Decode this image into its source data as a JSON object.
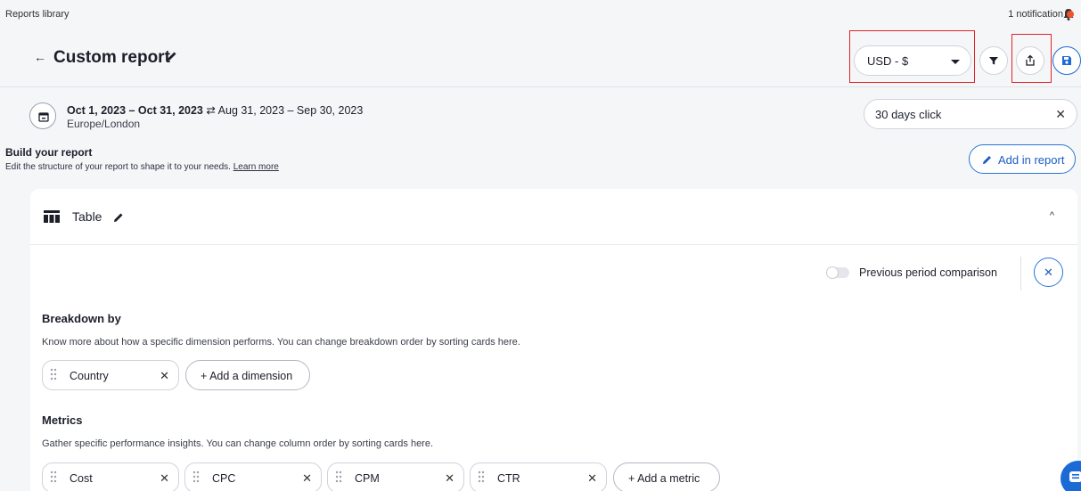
{
  "topbar": {
    "breadcrumb": "Reports library",
    "notification": "1 notification"
  },
  "header": {
    "back_icon": "back-arrow-icon",
    "title": "Custom report",
    "currency": "USD - $",
    "icons": [
      "edit-pencil-icon",
      "filter-icon",
      "export-icon",
      "save-icon"
    ]
  },
  "dates": {
    "range_main": "Oct 1, 2023 – Oct 31, 2023",
    "compare_arrow": "⇄",
    "range_compare": "Aug 31, 2023 – Sep 30, 2023",
    "timezone": "Europe/London",
    "attribution": "30 days click"
  },
  "build": {
    "title": "Build your report",
    "desc": "Edit the structure of your report to shape it to your needs.",
    "learn_more": "Learn more",
    "add_in_report": "Add in report"
  },
  "table_card": {
    "label": "Table",
    "prev_period": "Previous period comparison",
    "breakdown_title": "Breakdown by",
    "breakdown_desc": "Know more about how a specific dimension performs. You can change breakdown order by sorting cards here.",
    "dimensions": [
      "Country"
    ],
    "add_dimension": "+ Add a dimension",
    "metrics_title": "Metrics",
    "metrics_desc": "Gather specific performance insights. You can change column order by sorting cards here.",
    "metrics": [
      "Cost",
      "CPC",
      "CPM",
      "CTR"
    ],
    "add_metric": "+ Add a metric"
  },
  "colors": {
    "accent": "#1b6ad6",
    "highlight": "#e0242a",
    "notification_dot": "#f0532b"
  }
}
